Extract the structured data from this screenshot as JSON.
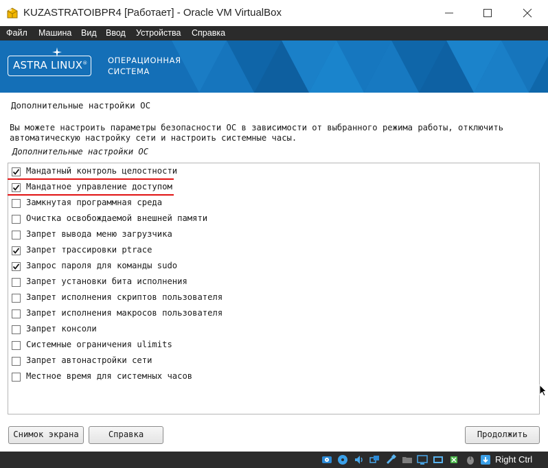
{
  "window": {
    "title": "KUZASTRATOIBPR4 [Работает] - Oracle VM VirtualBox",
    "controls": [
      "minimize-icon",
      "maximize-icon",
      "close-icon"
    ]
  },
  "menu": {
    "items": [
      "Файл",
      "Машина",
      "Вид",
      "Ввод",
      "Устройства",
      "Справка"
    ]
  },
  "banner": {
    "logo": "ASTRA LINUX",
    "logo_mark": "®",
    "subtitle_line1": "ОПЕРАЦИОННАЯ",
    "subtitle_line2": "СИСТЕМА",
    "color": "#146fb7"
  },
  "page": {
    "heading": "Дополнительные настройки ОС",
    "description_line1": "Вы можете настроить параметры безопасности ОС в зависимости от выбранного режима работы, отключить",
    "description_line2": "автоматическую настройку сети и настроить системные часы.",
    "group_label": "Дополнительные настройки ОС"
  },
  "options": [
    {
      "label": "Мандатный контроль целостности",
      "checked": true
    },
    {
      "label": "Мандатное управление доступом",
      "checked": true
    },
    {
      "label": "Замкнутая программная среда",
      "checked": false
    },
    {
      "label": "Очистка освобождаемой внешней памяти",
      "checked": false
    },
    {
      "label": "Запрет вывода меню загрузчика",
      "checked": false
    },
    {
      "label": "Запрет трассировки ptrace",
      "checked": true
    },
    {
      "label": "Запрос пароля для команды sudo",
      "checked": true
    },
    {
      "label": "Запрет установки бита исполнения",
      "checked": false
    },
    {
      "label": "Запрет исполнения скриптов пользователя",
      "checked": false
    },
    {
      "label": "Запрет исполнения макросов пользователя",
      "checked": false
    },
    {
      "label": "Запрет консоли",
      "checked": false
    },
    {
      "label": "Системные ограничения ulimits",
      "checked": false
    },
    {
      "label": "Запрет автонастройки сети",
      "checked": false
    },
    {
      "label": "Местное время для системных часов",
      "checked": false
    }
  ],
  "annotation_color": "#e01010",
  "buttons": {
    "screenshot": "Снимок экрана",
    "help": "Справка",
    "continue": "Продолжить"
  },
  "statusbar": {
    "icons": [
      "hard-disk-icon",
      "optical-drive-icon",
      "audio-icon",
      "network-icon",
      "usb-icon",
      "shared-folders-icon",
      "display-icon",
      "video-capture-icon",
      "cpu-icon",
      "mouse-integration-icon",
      "keyboard-capture-icon"
    ],
    "host_key": "Right Ctrl"
  }
}
